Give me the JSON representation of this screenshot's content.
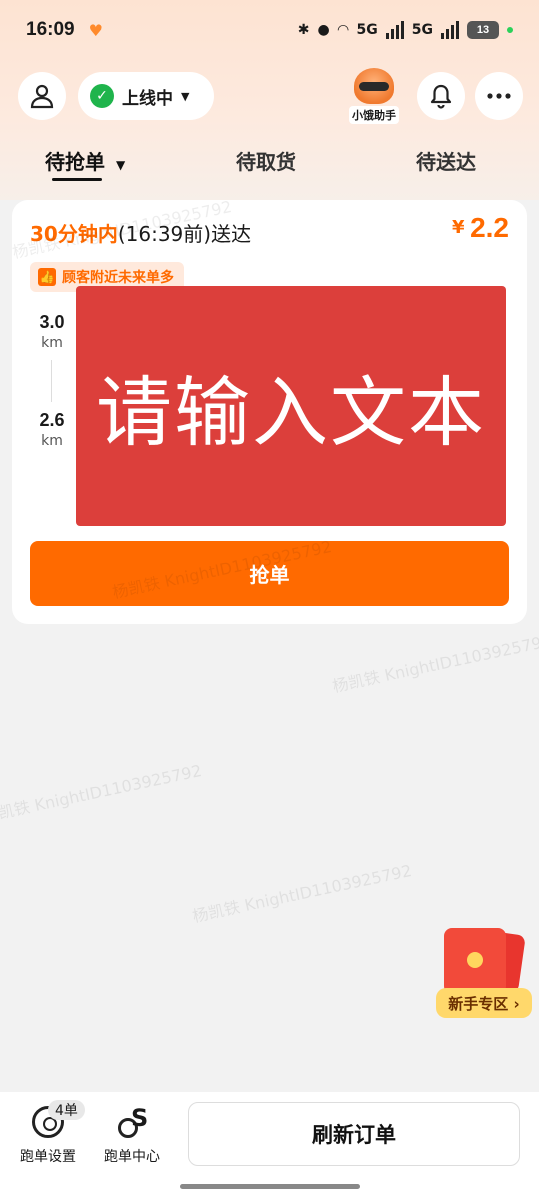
{
  "status_bar": {
    "time": "16:09",
    "signal_1": "5G",
    "signal_2": "5G",
    "battery": "13"
  },
  "header": {
    "online_status": "上线中",
    "assistant_label": "小饿助手"
  },
  "tabs": [
    {
      "label": "待抢单",
      "active": true
    },
    {
      "label": "待取货",
      "active": false
    },
    {
      "label": "待送达",
      "active": false
    }
  ],
  "order": {
    "deadline_highlight": "30分钟内",
    "deadline_rest": "(16:39前)送达",
    "price_symbol": "¥",
    "price_value": "2.2",
    "tag": "顾客附近未来单多",
    "pickup_distance": "3.0",
    "pickup_unit": "km",
    "delivery_distance": "2.6",
    "delivery_unit": "km",
    "overlay_text": "请输入文本",
    "grab_button": "抢单"
  },
  "promo": {
    "label": "新手专区 ›"
  },
  "bottom_nav": {
    "settings_label": "跑单设置",
    "settings_badge": "4单",
    "center_label": "跑单中心",
    "refresh_button": "刷新订单"
  },
  "watermark": "杨凯铁 KnightID1103925792",
  "colors": {
    "accent": "#ff6a00",
    "overlay": "#dc3f3b",
    "online": "#1fb44c"
  }
}
